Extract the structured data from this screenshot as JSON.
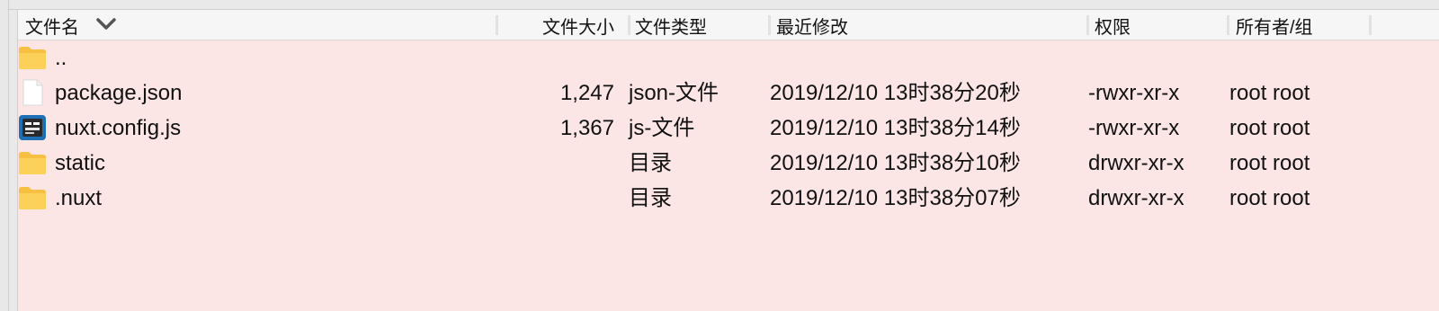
{
  "columns": {
    "name": "文件名",
    "size": "文件大小",
    "type": "文件类型",
    "modified": "最近修改",
    "permissions": "权限",
    "owner": "所有者/组"
  },
  "files": [
    {
      "icon": "folder-icon",
      "name": "..",
      "size": "",
      "type": "",
      "modified": "",
      "permissions": "",
      "owner": ""
    },
    {
      "icon": "file-icon",
      "name": "package.json",
      "size": "1,247",
      "type": "json-文件",
      "modified": "2019/12/10 13时38分20秒",
      "permissions": "-rwxr-xr-x",
      "owner": "root root"
    },
    {
      "icon": "js-file-icon",
      "name": "nuxt.config.js",
      "size": "1,367",
      "type": "js-文件",
      "modified": "2019/12/10 13时38分14秒",
      "permissions": "-rwxr-xr-x",
      "owner": "root root"
    },
    {
      "icon": "folder-icon",
      "name": "static",
      "size": "",
      "type": "目录",
      "modified": "2019/12/10 13时38分10秒",
      "permissions": "drwxr-xr-x",
      "owner": "root root"
    },
    {
      "icon": "folder-icon",
      "name": ".nuxt",
      "size": "",
      "type": "目录",
      "modified": "2019/12/10 13时38分07秒",
      "permissions": "drwxr-xr-x",
      "owner": "root root"
    }
  ]
}
